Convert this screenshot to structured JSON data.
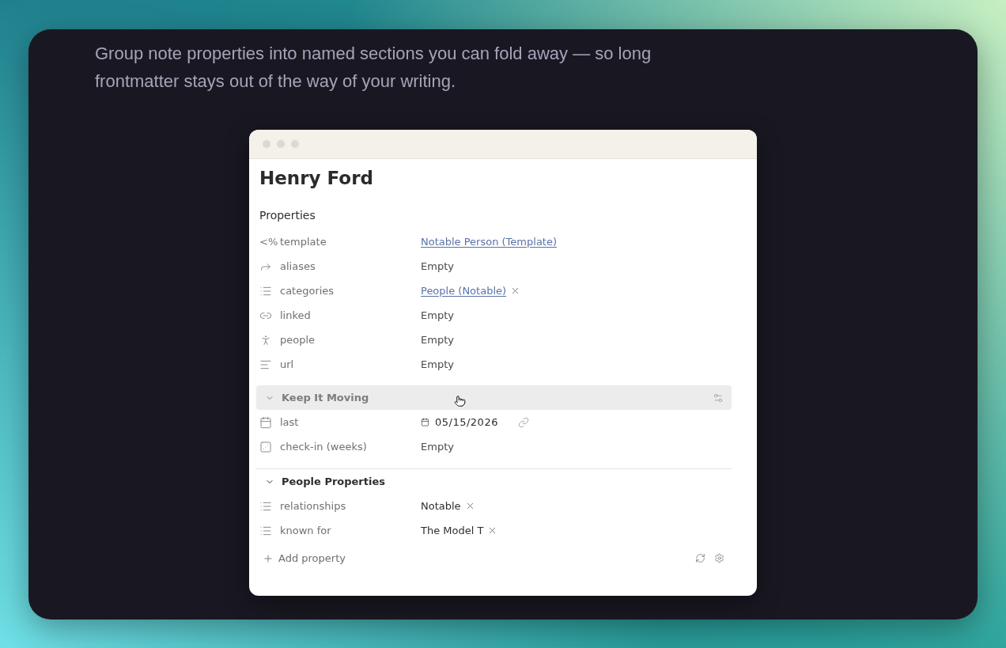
{
  "intro": "Group note properties into named sections you can fold away — so long frontmatter stays out of the way of your writing.",
  "note": {
    "title": "Henry Ford",
    "properties_heading": "Properties",
    "properties": [
      {
        "kind": "template",
        "glyph": "<%",
        "label": "template",
        "value": {
          "kind": "link",
          "text": "Notable Person (Template)",
          "removable": false
        }
      },
      {
        "kind": "aliases",
        "label": "aliases",
        "value": {
          "kind": "empty",
          "text": "Empty",
          "removable": false
        }
      },
      {
        "kind": "list",
        "label": "categories",
        "value": {
          "kind": "link",
          "text": "People (Notable)",
          "removable": true
        }
      },
      {
        "kind": "links",
        "label": "linked",
        "value": {
          "kind": "empty",
          "text": "Empty",
          "removable": false
        }
      },
      {
        "kind": "person",
        "label": "people",
        "value": {
          "kind": "empty",
          "text": "Empty",
          "removable": false
        }
      },
      {
        "kind": "text",
        "label": "url",
        "value": {
          "kind": "empty",
          "text": "Empty",
          "removable": false
        }
      }
    ],
    "sections": [
      {
        "title": "Keep It Moving",
        "expanded": true,
        "hovered": true,
        "properties": [
          {
            "kind": "date",
            "label": "last",
            "value": {
              "kind": "date",
              "text": "05/15/2026",
              "removable": false
            }
          },
          {
            "kind": "number",
            "label": "check-in (weeks)",
            "value": {
              "kind": "empty",
              "text": "Empty",
              "removable": false
            }
          }
        ]
      },
      {
        "title": "People Properties",
        "expanded": true,
        "hovered": false,
        "properties": [
          {
            "kind": "list",
            "label": "relationships",
            "value": {
              "kind": "tag",
              "text": "Notable",
              "removable": true
            }
          },
          {
            "kind": "list",
            "label": "known for",
            "value": {
              "kind": "tag",
              "text": "The Model T",
              "removable": true
            }
          }
        ]
      }
    ],
    "add_property": "Add property"
  }
}
